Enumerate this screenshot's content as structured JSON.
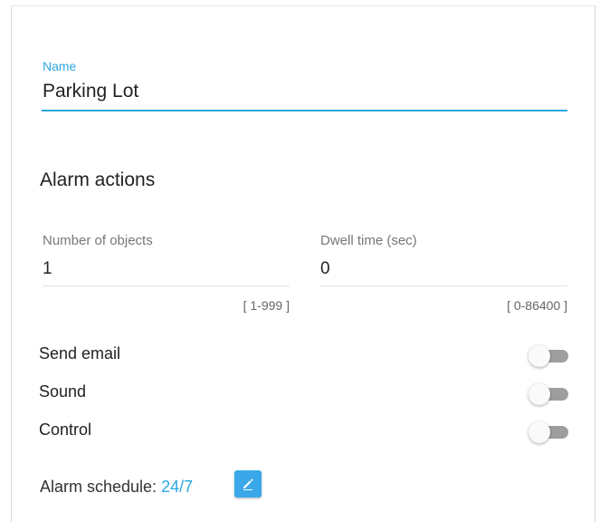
{
  "name_field": {
    "label": "Name",
    "value": "Parking Lot"
  },
  "alarm_actions": {
    "title": "Alarm actions",
    "number_of_objects": {
      "label": "Number of objects",
      "value": "1",
      "range": "[ 1-999 ]"
    },
    "dwell_time": {
      "label": "Dwell time (sec)",
      "value": "0",
      "range": "[ 0-86400 ]"
    }
  },
  "toggles": [
    {
      "label": "Send email",
      "on": false
    },
    {
      "label": "Sound",
      "on": false
    },
    {
      "label": "Control",
      "on": false
    }
  ],
  "schedule": {
    "label": "Alarm schedule:",
    "value": "24/7",
    "edit_icon": "pencil-icon"
  },
  "colors": {
    "accent": "#2aa7e0",
    "edit_button": "#3aa8e8",
    "toggle_off_track": "#9e9e9e"
  }
}
